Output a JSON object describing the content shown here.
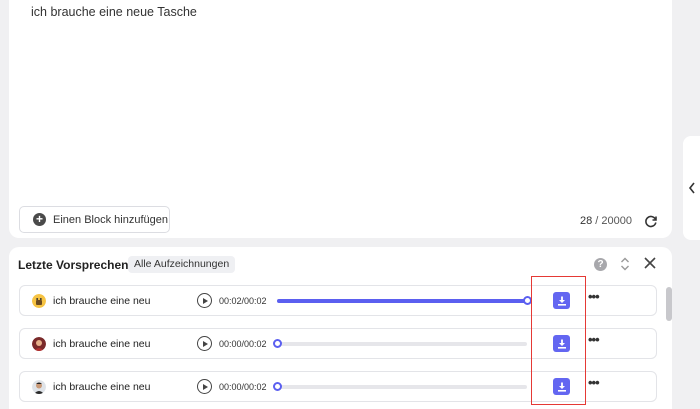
{
  "editor": {
    "text": "ich brauche eine neue Tasche",
    "add_block_label": "Einen Block hinzufügen",
    "char_count": "28",
    "char_limit": "/ 20000"
  },
  "panel": {
    "title": "Letzte Vorsprechen",
    "all_recordings_label": "Alle Aufzeichnungen",
    "help_label": "?"
  },
  "rows": [
    {
      "text": "ich brauche eine neu",
      "time": "00:02/00:02",
      "progress": 1.0
    },
    {
      "text": "ich brauche eine neu",
      "time": "00:00/00:02",
      "progress": 0.0
    },
    {
      "text": "ich brauche eine neu",
      "time": "00:00/00:02",
      "progress": 0.0
    }
  ],
  "colors": {
    "accent": "#6366f1",
    "highlight": "#e53935"
  },
  "icons": [
    "plus-circle-icon",
    "refresh-icon",
    "chevron-left-icon",
    "help-icon",
    "sort-icon",
    "close-icon",
    "play-icon",
    "download-icon",
    "more-icon"
  ]
}
